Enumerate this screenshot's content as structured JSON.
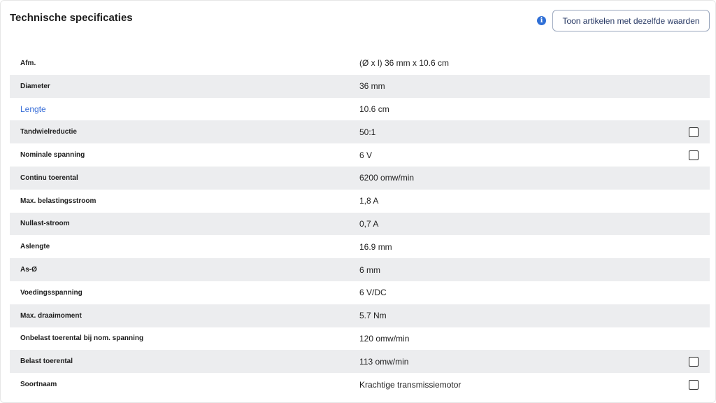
{
  "header": {
    "title": "Technische specificaties",
    "info_icon": "info-icon",
    "same_values_button": "Toon artikelen met dezelfde waarden"
  },
  "specs": [
    {
      "label": "Afm.",
      "value": "(Ø x l) 36 mm x 10.6 cm",
      "checkbox": false,
      "link": false
    },
    {
      "label": "Diameter",
      "value": "36 mm",
      "checkbox": false,
      "link": false
    },
    {
      "label": "Lengte",
      "value": "10.6 cm",
      "checkbox": false,
      "link": true
    },
    {
      "label": "Tandwielreductie",
      "value": "50:1",
      "checkbox": true,
      "link": false
    },
    {
      "label": "Nominale spanning",
      "value": "6 V",
      "checkbox": true,
      "link": false
    },
    {
      "label": "Continu toerental",
      "value": "6200 omw/min",
      "checkbox": false,
      "link": false
    },
    {
      "label": "Max. belastingsstroom",
      "value": "1,8 A",
      "checkbox": false,
      "link": false
    },
    {
      "label": "Nullast-stroom",
      "value": "0,7 A",
      "checkbox": false,
      "link": false
    },
    {
      "label": "Aslengte",
      "value": "16.9 mm",
      "checkbox": false,
      "link": false
    },
    {
      "label": "As-Ø",
      "value": "6 mm",
      "checkbox": false,
      "link": false
    },
    {
      "label": "Voedingsspanning",
      "value": "6 V/DC",
      "checkbox": false,
      "link": false
    },
    {
      "label": "Max. draaimoment",
      "value": "5.7 Nm",
      "checkbox": false,
      "link": false
    },
    {
      "label": "Onbelast toerental bij nom. spanning",
      "value": "120 omw/min",
      "checkbox": false,
      "link": false
    },
    {
      "label": "Belast toerental",
      "value": "113 omw/min",
      "checkbox": true,
      "link": false
    },
    {
      "label": "Soortnaam",
      "value": "Krachtige transmissiemotor",
      "checkbox": true,
      "link": false
    }
  ]
}
